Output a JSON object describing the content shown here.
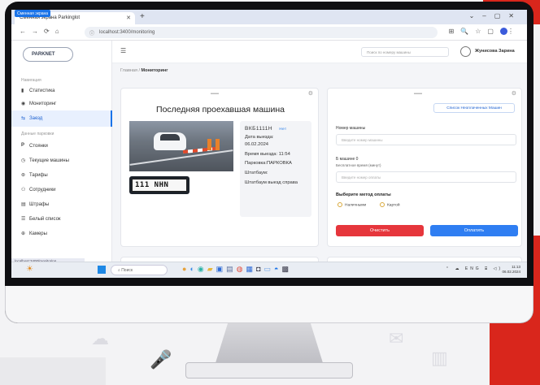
{
  "browser": {
    "tab_badge": "Сменная экрана",
    "tab_title": "Сменная экрана  Parkinglot",
    "url": "localhost:3400/monitoring"
  },
  "app": {
    "logo": "PARKNET",
    "sidebar": {
      "section_main": "Навигация",
      "section_ref": "Данные парковки",
      "items": [
        {
          "label": "Статистика",
          "icon": "chart-icon"
        },
        {
          "label": "Мониторинг",
          "icon": "eye-icon"
        },
        {
          "label": "Заезд",
          "icon": "car-icon"
        },
        {
          "label": "Стоянки",
          "icon": "parking-icon"
        },
        {
          "label": "Текущие машины",
          "icon": "clock-icon"
        },
        {
          "label": "Тарифы",
          "icon": "tag-icon"
        },
        {
          "label": "Сотрудники",
          "icon": "users-icon"
        },
        {
          "label": "Штрафы",
          "icon": "receipt-icon"
        },
        {
          "label": "Белый список",
          "icon": "list-icon"
        },
        {
          "label": "Камеры",
          "icon": "camera-icon"
        }
      ],
      "active_index": 2,
      "status_url": "localhost:3400/monitoring"
    },
    "topbar": {
      "search_placeholder": "Поиск по номеру машины",
      "user_name": "Жунисова Зарина"
    },
    "breadcrumb": {
      "home": "Главная",
      "current": "Мониторинг"
    },
    "last_car": {
      "title": "Последняя проехавшая машина",
      "plate_photo": "111 NHN",
      "plate_number": "ВКБ1111Н",
      "plate_action": "Нет",
      "date_label": "Дата выезда:",
      "date_value": "06.02.2024",
      "time_line": "Время выезда: 11:54",
      "parking_line": "Парковка:ПАРКОВКА",
      "fine_line": "Штатбаум:",
      "fine_extra": "Штатбаум выезд справа"
    },
    "payment": {
      "list_button": "Список Неоплаченных Машин",
      "plate_label": "Номер машины",
      "plate_placeholder": "Введите номер машины",
      "minutes_label": "Б машине 0",
      "minutes_sub": "Бесплатное время (минут)",
      "minutes_placeholder": "Введите номер оплаты",
      "method_label": "Выберите метод оплаты",
      "method_cash": "Наличными",
      "method_card": "Картой",
      "clear_button": "Очистить",
      "pay_button": "Оплатить"
    }
  },
  "taskbar": {
    "search": "Поиск",
    "lang": "ENG",
    "time": "11:13",
    "date": "06.02.2024"
  },
  "colors": {
    "accent": "#1a73e8",
    "brand_red": "#d9261c",
    "clear_red": "#e6363c",
    "pay_blue": "#2f7ef2"
  }
}
